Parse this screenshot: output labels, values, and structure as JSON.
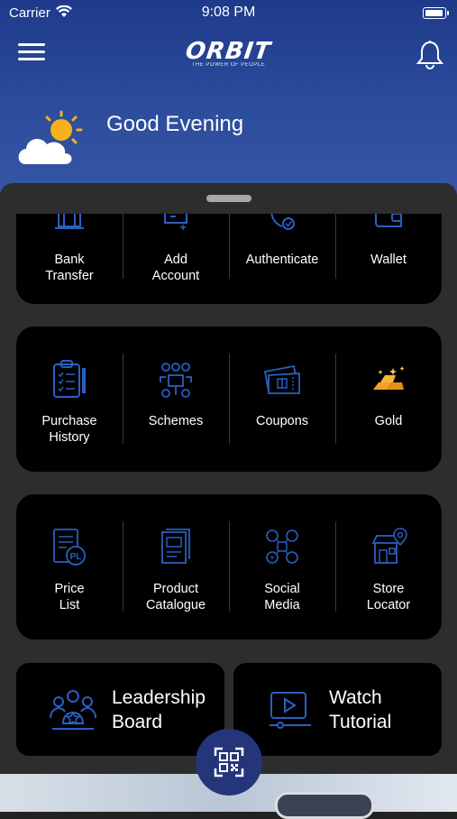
{
  "status_bar": {
    "carrier": "Carrier",
    "time": "9:08 PM"
  },
  "header": {
    "brand": "ORBIT",
    "tagline": "THE POWER OF PEOPLE"
  },
  "greeting": "Good Evening",
  "row1": [
    {
      "label": "Bank\nTransfer",
      "icon": "bank-icon"
    },
    {
      "label": "Add\nAccount",
      "icon": "add-account-icon"
    },
    {
      "label": "Authenticate",
      "icon": "authenticate-icon"
    },
    {
      "label": "Wallet",
      "icon": "wallet-icon"
    }
  ],
  "row2": [
    {
      "label": "Purchase\nHistory",
      "icon": "clipboard-icon"
    },
    {
      "label": "Schemes",
      "icon": "schemes-icon"
    },
    {
      "label": "Coupons",
      "icon": "coupon-icon"
    },
    {
      "label": "Gold",
      "icon": "gold-bars-icon"
    }
  ],
  "row3": [
    {
      "label": "Price\nList",
      "icon": "price-list-icon"
    },
    {
      "label": "Product\nCatalogue",
      "icon": "catalogue-icon"
    },
    {
      "label": "Social\nMedia",
      "icon": "social-media-icon"
    },
    {
      "label": "Store\nLocator",
      "icon": "store-locator-icon"
    }
  ],
  "tiles": [
    {
      "label": "Leadership\nBoard",
      "icon": "leaderboard-icon"
    },
    {
      "label": "Watch\nTutorial",
      "icon": "video-icon"
    }
  ],
  "colors": {
    "accent": "#2b5fc0",
    "gold": "#f0a22a",
    "fab": "#24357a"
  }
}
